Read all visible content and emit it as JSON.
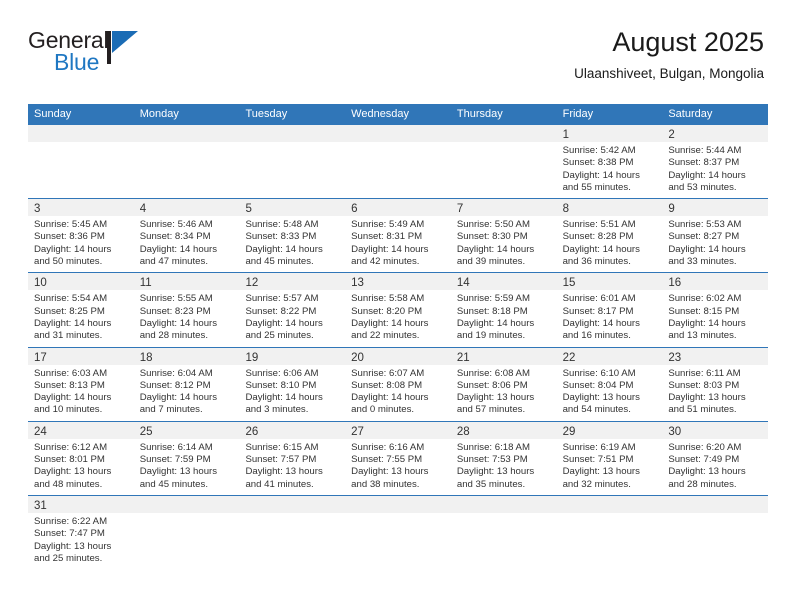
{
  "logo": {
    "word_one": "General",
    "word_two": "Blue",
    "triangle_icon": "triangle-right-icon",
    "brand_blue": "#1b6cb5",
    "brand_black": "#231f20"
  },
  "header": {
    "title": "August 2025",
    "subtitle": "Ulaanshiveet, Bulgan, Mongolia"
  },
  "theme": {
    "header_blue": "#3076b8",
    "daynum_band": "#f1f1f1",
    "text": "#333333"
  },
  "calendar": {
    "weekday_headers": [
      "Sunday",
      "Monday",
      "Tuesday",
      "Wednesday",
      "Thursday",
      "Friday",
      "Saturday"
    ],
    "labels": {
      "sunrise_prefix": "Sunrise:",
      "sunset_prefix": "Sunset:",
      "daylight_prefix": "Daylight:"
    },
    "weeks": [
      [
        {
          "day": "",
          "sunrise": "",
          "sunset": "",
          "daylight_line1": "",
          "daylight_line2": ""
        },
        {
          "day": "",
          "sunrise": "",
          "sunset": "",
          "daylight_line1": "",
          "daylight_line2": ""
        },
        {
          "day": "",
          "sunrise": "",
          "sunset": "",
          "daylight_line1": "",
          "daylight_line2": ""
        },
        {
          "day": "",
          "sunrise": "",
          "sunset": "",
          "daylight_line1": "",
          "daylight_line2": ""
        },
        {
          "day": "",
          "sunrise": "",
          "sunset": "",
          "daylight_line1": "",
          "daylight_line2": ""
        },
        {
          "day": "1",
          "sunrise": "Sunrise: 5:42 AM",
          "sunset": "Sunset: 8:38 PM",
          "daylight_line1": "Daylight: 14 hours",
          "daylight_line2": "and 55 minutes."
        },
        {
          "day": "2",
          "sunrise": "Sunrise: 5:44 AM",
          "sunset": "Sunset: 8:37 PM",
          "daylight_line1": "Daylight: 14 hours",
          "daylight_line2": "and 53 minutes."
        }
      ],
      [
        {
          "day": "3",
          "sunrise": "Sunrise: 5:45 AM",
          "sunset": "Sunset: 8:36 PM",
          "daylight_line1": "Daylight: 14 hours",
          "daylight_line2": "and 50 minutes."
        },
        {
          "day": "4",
          "sunrise": "Sunrise: 5:46 AM",
          "sunset": "Sunset: 8:34 PM",
          "daylight_line1": "Daylight: 14 hours",
          "daylight_line2": "and 47 minutes."
        },
        {
          "day": "5",
          "sunrise": "Sunrise: 5:48 AM",
          "sunset": "Sunset: 8:33 PM",
          "daylight_line1": "Daylight: 14 hours",
          "daylight_line2": "and 45 minutes."
        },
        {
          "day": "6",
          "sunrise": "Sunrise: 5:49 AM",
          "sunset": "Sunset: 8:31 PM",
          "daylight_line1": "Daylight: 14 hours",
          "daylight_line2": "and 42 minutes."
        },
        {
          "day": "7",
          "sunrise": "Sunrise: 5:50 AM",
          "sunset": "Sunset: 8:30 PM",
          "daylight_line1": "Daylight: 14 hours",
          "daylight_line2": "and 39 minutes."
        },
        {
          "day": "8",
          "sunrise": "Sunrise: 5:51 AM",
          "sunset": "Sunset: 8:28 PM",
          "daylight_line1": "Daylight: 14 hours",
          "daylight_line2": "and 36 minutes."
        },
        {
          "day": "9",
          "sunrise": "Sunrise: 5:53 AM",
          "sunset": "Sunset: 8:27 PM",
          "daylight_line1": "Daylight: 14 hours",
          "daylight_line2": "and 33 minutes."
        }
      ],
      [
        {
          "day": "10",
          "sunrise": "Sunrise: 5:54 AM",
          "sunset": "Sunset: 8:25 PM",
          "daylight_line1": "Daylight: 14 hours",
          "daylight_line2": "and 31 minutes."
        },
        {
          "day": "11",
          "sunrise": "Sunrise: 5:55 AM",
          "sunset": "Sunset: 8:23 PM",
          "daylight_line1": "Daylight: 14 hours",
          "daylight_line2": "and 28 minutes."
        },
        {
          "day": "12",
          "sunrise": "Sunrise: 5:57 AM",
          "sunset": "Sunset: 8:22 PM",
          "daylight_line1": "Daylight: 14 hours",
          "daylight_line2": "and 25 minutes."
        },
        {
          "day": "13",
          "sunrise": "Sunrise: 5:58 AM",
          "sunset": "Sunset: 8:20 PM",
          "daylight_line1": "Daylight: 14 hours",
          "daylight_line2": "and 22 minutes."
        },
        {
          "day": "14",
          "sunrise": "Sunrise: 5:59 AM",
          "sunset": "Sunset: 8:18 PM",
          "daylight_line1": "Daylight: 14 hours",
          "daylight_line2": "and 19 minutes."
        },
        {
          "day": "15",
          "sunrise": "Sunrise: 6:01 AM",
          "sunset": "Sunset: 8:17 PM",
          "daylight_line1": "Daylight: 14 hours",
          "daylight_line2": "and 16 minutes."
        },
        {
          "day": "16",
          "sunrise": "Sunrise: 6:02 AM",
          "sunset": "Sunset: 8:15 PM",
          "daylight_line1": "Daylight: 14 hours",
          "daylight_line2": "and 13 minutes."
        }
      ],
      [
        {
          "day": "17",
          "sunrise": "Sunrise: 6:03 AM",
          "sunset": "Sunset: 8:13 PM",
          "daylight_line1": "Daylight: 14 hours",
          "daylight_line2": "and 10 minutes."
        },
        {
          "day": "18",
          "sunrise": "Sunrise: 6:04 AM",
          "sunset": "Sunset: 8:12 PM",
          "daylight_line1": "Daylight: 14 hours",
          "daylight_line2": "and 7 minutes."
        },
        {
          "day": "19",
          "sunrise": "Sunrise: 6:06 AM",
          "sunset": "Sunset: 8:10 PM",
          "daylight_line1": "Daylight: 14 hours",
          "daylight_line2": "and 3 minutes."
        },
        {
          "day": "20",
          "sunrise": "Sunrise: 6:07 AM",
          "sunset": "Sunset: 8:08 PM",
          "daylight_line1": "Daylight: 14 hours",
          "daylight_line2": "and 0 minutes."
        },
        {
          "day": "21",
          "sunrise": "Sunrise: 6:08 AM",
          "sunset": "Sunset: 8:06 PM",
          "daylight_line1": "Daylight: 13 hours",
          "daylight_line2": "and 57 minutes."
        },
        {
          "day": "22",
          "sunrise": "Sunrise: 6:10 AM",
          "sunset": "Sunset: 8:04 PM",
          "daylight_line1": "Daylight: 13 hours",
          "daylight_line2": "and 54 minutes."
        },
        {
          "day": "23",
          "sunrise": "Sunrise: 6:11 AM",
          "sunset": "Sunset: 8:03 PM",
          "daylight_line1": "Daylight: 13 hours",
          "daylight_line2": "and 51 minutes."
        }
      ],
      [
        {
          "day": "24",
          "sunrise": "Sunrise: 6:12 AM",
          "sunset": "Sunset: 8:01 PM",
          "daylight_line1": "Daylight: 13 hours",
          "daylight_line2": "and 48 minutes."
        },
        {
          "day": "25",
          "sunrise": "Sunrise: 6:14 AM",
          "sunset": "Sunset: 7:59 PM",
          "daylight_line1": "Daylight: 13 hours",
          "daylight_line2": "and 45 minutes."
        },
        {
          "day": "26",
          "sunrise": "Sunrise: 6:15 AM",
          "sunset": "Sunset: 7:57 PM",
          "daylight_line1": "Daylight: 13 hours",
          "daylight_line2": "and 41 minutes."
        },
        {
          "day": "27",
          "sunrise": "Sunrise: 6:16 AM",
          "sunset": "Sunset: 7:55 PM",
          "daylight_line1": "Daylight: 13 hours",
          "daylight_line2": "and 38 minutes."
        },
        {
          "day": "28",
          "sunrise": "Sunrise: 6:18 AM",
          "sunset": "Sunset: 7:53 PM",
          "daylight_line1": "Daylight: 13 hours",
          "daylight_line2": "and 35 minutes."
        },
        {
          "day": "29",
          "sunrise": "Sunrise: 6:19 AM",
          "sunset": "Sunset: 7:51 PM",
          "daylight_line1": "Daylight: 13 hours",
          "daylight_line2": "and 32 minutes."
        },
        {
          "day": "30",
          "sunrise": "Sunrise: 6:20 AM",
          "sunset": "Sunset: 7:49 PM",
          "daylight_line1": "Daylight: 13 hours",
          "daylight_line2": "and 28 minutes."
        }
      ],
      [
        {
          "day": "31",
          "sunrise": "Sunrise: 6:22 AM",
          "sunset": "Sunset: 7:47 PM",
          "daylight_line1": "Daylight: 13 hours",
          "daylight_line2": "and 25 minutes."
        },
        {
          "day": "",
          "sunrise": "",
          "sunset": "",
          "daylight_line1": "",
          "daylight_line2": ""
        },
        {
          "day": "",
          "sunrise": "",
          "sunset": "",
          "daylight_line1": "",
          "daylight_line2": ""
        },
        {
          "day": "",
          "sunrise": "",
          "sunset": "",
          "daylight_line1": "",
          "daylight_line2": ""
        },
        {
          "day": "",
          "sunrise": "",
          "sunset": "",
          "daylight_line1": "",
          "daylight_line2": ""
        },
        {
          "day": "",
          "sunrise": "",
          "sunset": "",
          "daylight_line1": "",
          "daylight_line2": ""
        },
        {
          "day": "",
          "sunrise": "",
          "sunset": "",
          "daylight_line1": "",
          "daylight_line2": ""
        }
      ]
    ]
  }
}
